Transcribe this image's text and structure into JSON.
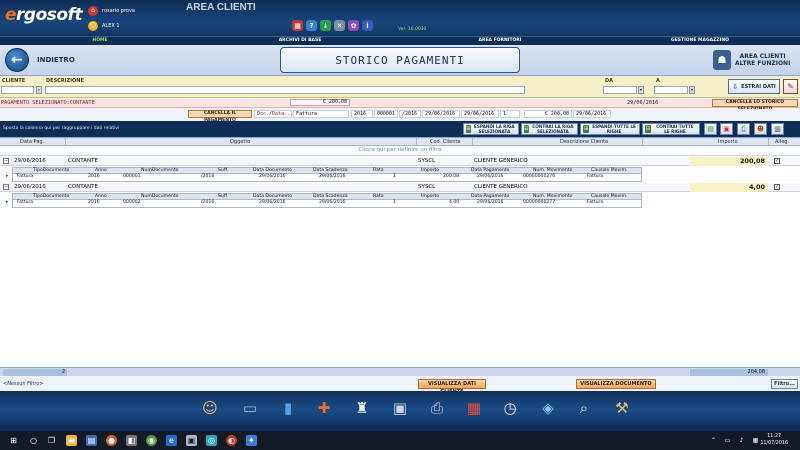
{
  "header": {
    "logo": {
      "prefix": "e",
      "rest": "rgosoft"
    },
    "users": [
      {
        "name": "rosario prova",
        "icon": "home-icon"
      },
      {
        "name": "ALEX 1",
        "icon": "user-icon"
      }
    ],
    "app_title": "AREA CLIENTI",
    "version": "Ver. 16.0030",
    "toolbar_icons": [
      "calculator-icon",
      "help-icon",
      "download-icon",
      "close-icon",
      "settings-icon",
      "info-icon"
    ]
  },
  "nav": {
    "items": [
      "HOME",
      "ARCHIVI DI BASE",
      "AREA FORNITORI",
      "GESTIONE MAGAZZINO"
    ]
  },
  "titlebar": {
    "back_label": "INDIETRO",
    "page_title": "STORICO PAGAMENTI",
    "altre_line1": "AREA CLIENTI",
    "altre_line2": "ALTRE FUNZIONI"
  },
  "filter": {
    "cliente_label": "CLIENTE",
    "descrizione_label": "DESCRIZIONE",
    "da_label": "DA",
    "a_label": "A",
    "estrai_label": "ESTRAI DATI"
  },
  "selected": {
    "label": "PAGAMENTO SELEZIONATO:CONTANTE",
    "amount": "€ 200,08",
    "date": "29/06/2016",
    "cancel_storico": "CANCELLA LO STORICO SELEZIONATO"
  },
  "docrow": {
    "cancel_payment": "CANCELLA IL PAGAMENTO",
    "doc_label": "Doc./Data...",
    "tipo": "Fattura",
    "anno": "2016",
    "numero": "000001",
    "suff": "/2016",
    "data_doc": "29/06/2016",
    "data_scad": "29/06/2016",
    "rata": "1",
    "importo": "€ 200,08",
    "data_pag": "29/06/2016"
  },
  "groupbar": {
    "hint": "Sposta la colonna qui per raggruppare i dati relativi",
    "buttons": [
      "ESPANDI LA RIGA SELEZIONATA",
      "CONTRAI LA RIGA SELEZIONATA",
      "ESPANDI TUTTE LE RIGHE",
      "CONTRAI TUTTE LE RIGHE"
    ]
  },
  "grid": {
    "columns": [
      "Data Pag.",
      "Oggetto",
      "Cod. Cliente",
      "Descrizione Cliente",
      "Importo",
      "Alleg."
    ],
    "filter_hint": "Clicca qui per definire un filtro",
    "sub_columns": [
      "TipoDocumento",
      "Anno",
      "NumDocumento",
      "Suff.",
      "Data Documento",
      "Data Scadenza",
      "Rata",
      "Importo",
      "Data Pagamento",
      "Num. Movimento",
      "Causale Movim."
    ],
    "rows": [
      {
        "data_pag": "29/06/2016",
        "oggetto": "CONTANTE",
        "cod_cliente": "SYSCL",
        "descrizione": "CLIENTE GENERICO",
        "importo": "200,08",
        "alleg": "✓",
        "detail": {
          "tipo": "Fattura",
          "anno": "2016",
          "num": "000001",
          "suff": "/2016",
          "data_doc": "29/06/2016",
          "data_scad": "29/06/2016",
          "rata": "1",
          "importo": "200,08",
          "data_pag": "29/06/2016",
          "num_mov": "00000000276",
          "causale": "Fattura"
        }
      },
      {
        "data_pag": "29/06/2016",
        "oggetto": "CONTANTE",
        "cod_cliente": "SYSCL",
        "descrizione": "CLIENTE GENERICO",
        "importo": "4,00",
        "alleg": "✓",
        "detail": {
          "tipo": "Fattura",
          "anno": "2016",
          "num": "000002",
          "suff": "/2016",
          "data_doc": "29/06/2016",
          "data_scad": "29/06/2016",
          "rata": "1",
          "importo": "4,00",
          "data_pag": "29/06/2016",
          "num_mov": "00000000277",
          "causale": "Fattura"
        }
      }
    ],
    "count": "2",
    "total": "204,08"
  },
  "bottombar": {
    "no_filter": "<Nessun Filtro>",
    "visualizza_cliente": "VISUALIZZA DATI CLIENTE",
    "visualizza_documento": "VISUALIZZA DOCUMENTO",
    "filtro": "Filtro..."
  },
  "taskbar": {
    "time": "11:27",
    "date": "11/07/2016"
  }
}
